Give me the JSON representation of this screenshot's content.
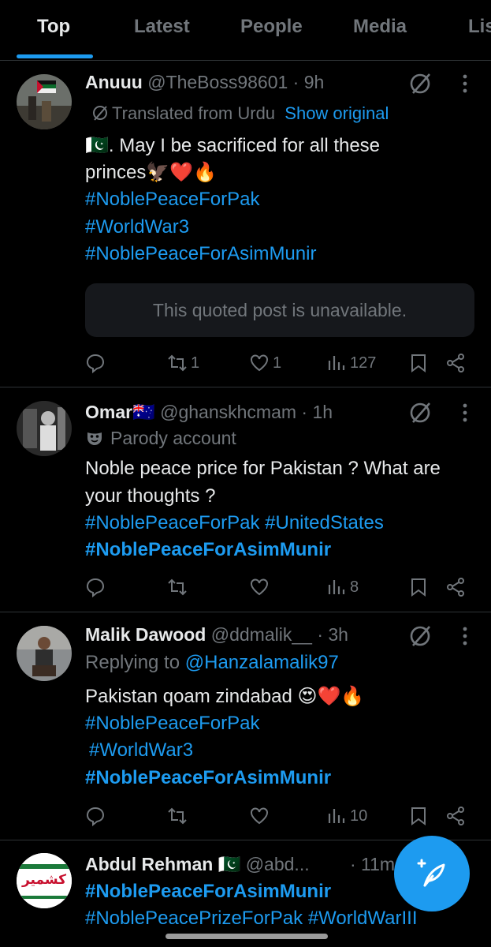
{
  "tabs": [
    "Top",
    "Latest",
    "People",
    "Media",
    "Lis"
  ],
  "posts": [
    {
      "name": "Anuuu",
      "meta": " @TheBoss98601 · 9h",
      "translated": "Translated from Urdu",
      "show_original": "Show original",
      "text1": "🇵🇰. May I be sacrificed for all these",
      "text2": "princes🦅❤️🔥",
      "tags": [
        "#NoblePeaceForPak",
        "#WorldWar3",
        "#NoblePeaceForAsimMunir"
      ],
      "quoted": "This quoted post is unavailable.",
      "replies": "",
      "reposts": "1",
      "likes": "1",
      "views": "127"
    },
    {
      "name": "Omar🇦🇺",
      "meta": " @ghanskhcmam · 1h",
      "parody": "Parody account",
      "text1": "Noble peace price for Pakistan ? What are",
      "text2": "your thoughts ?",
      "tag_line1a": "#NoblePeaceForPak",
      "tag_line1b": "#UnitedStates",
      "tag_line2": "#NoblePeaceForAsimMunir",
      "views": "8"
    },
    {
      "name": "Malik Dawood",
      "meta": " @ddmalik__ · 3h",
      "replying_prefix": "Replying to ",
      "replying_to": "@Hanzalamalik97",
      "text1": "Pakistan qoam zindabad 😍❤️🔥",
      "tags": [
        "#NoblePeaceForPak",
        "#WorldWar3",
        "#NoblePeaceForAsimMunir"
      ],
      "views": "10"
    },
    {
      "name": "Abdul Rehman 🇵🇰",
      "meta": " @abd...",
      "time": "· 11m",
      "tag1": "#NoblePeaceForAsimMunir",
      "tag2a": "#NoblePeacePrizeForPak",
      "tag2b": "#WorldWarIII",
      "avatar_text": "کشمیر"
    }
  ],
  "colors": {
    "accent": "#1d9bf0",
    "muted": "#71767b",
    "text": "#e7e9ea",
    "divider": "#2f3336"
  }
}
